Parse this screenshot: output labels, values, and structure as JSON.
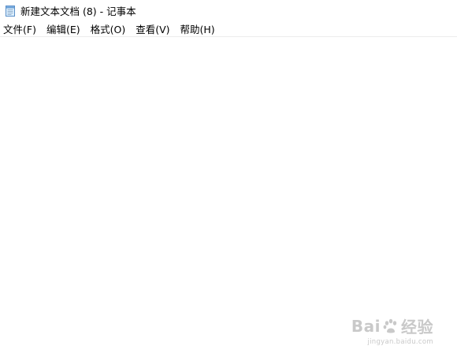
{
  "window": {
    "title": "新建文本文档 (8) - 记事本"
  },
  "menu": {
    "items": [
      {
        "label": "文件(F)"
      },
      {
        "label": "编辑(E)"
      },
      {
        "label": "格式(O)"
      },
      {
        "label": "查看(V)"
      },
      {
        "label": "帮助(H)"
      }
    ]
  },
  "editor": {
    "value": ""
  },
  "icons": {
    "app": "notepad-icon",
    "watermark": "baidu-paw-icon"
  },
  "watermark": {
    "logo_left": "Bai",
    "logo_right": "经验",
    "url": "jingyan.baidu.com"
  },
  "colors": {
    "background": "#ffffff",
    "text": "#000000",
    "divider": "#ececec",
    "watermark": "#c9c9c9"
  }
}
